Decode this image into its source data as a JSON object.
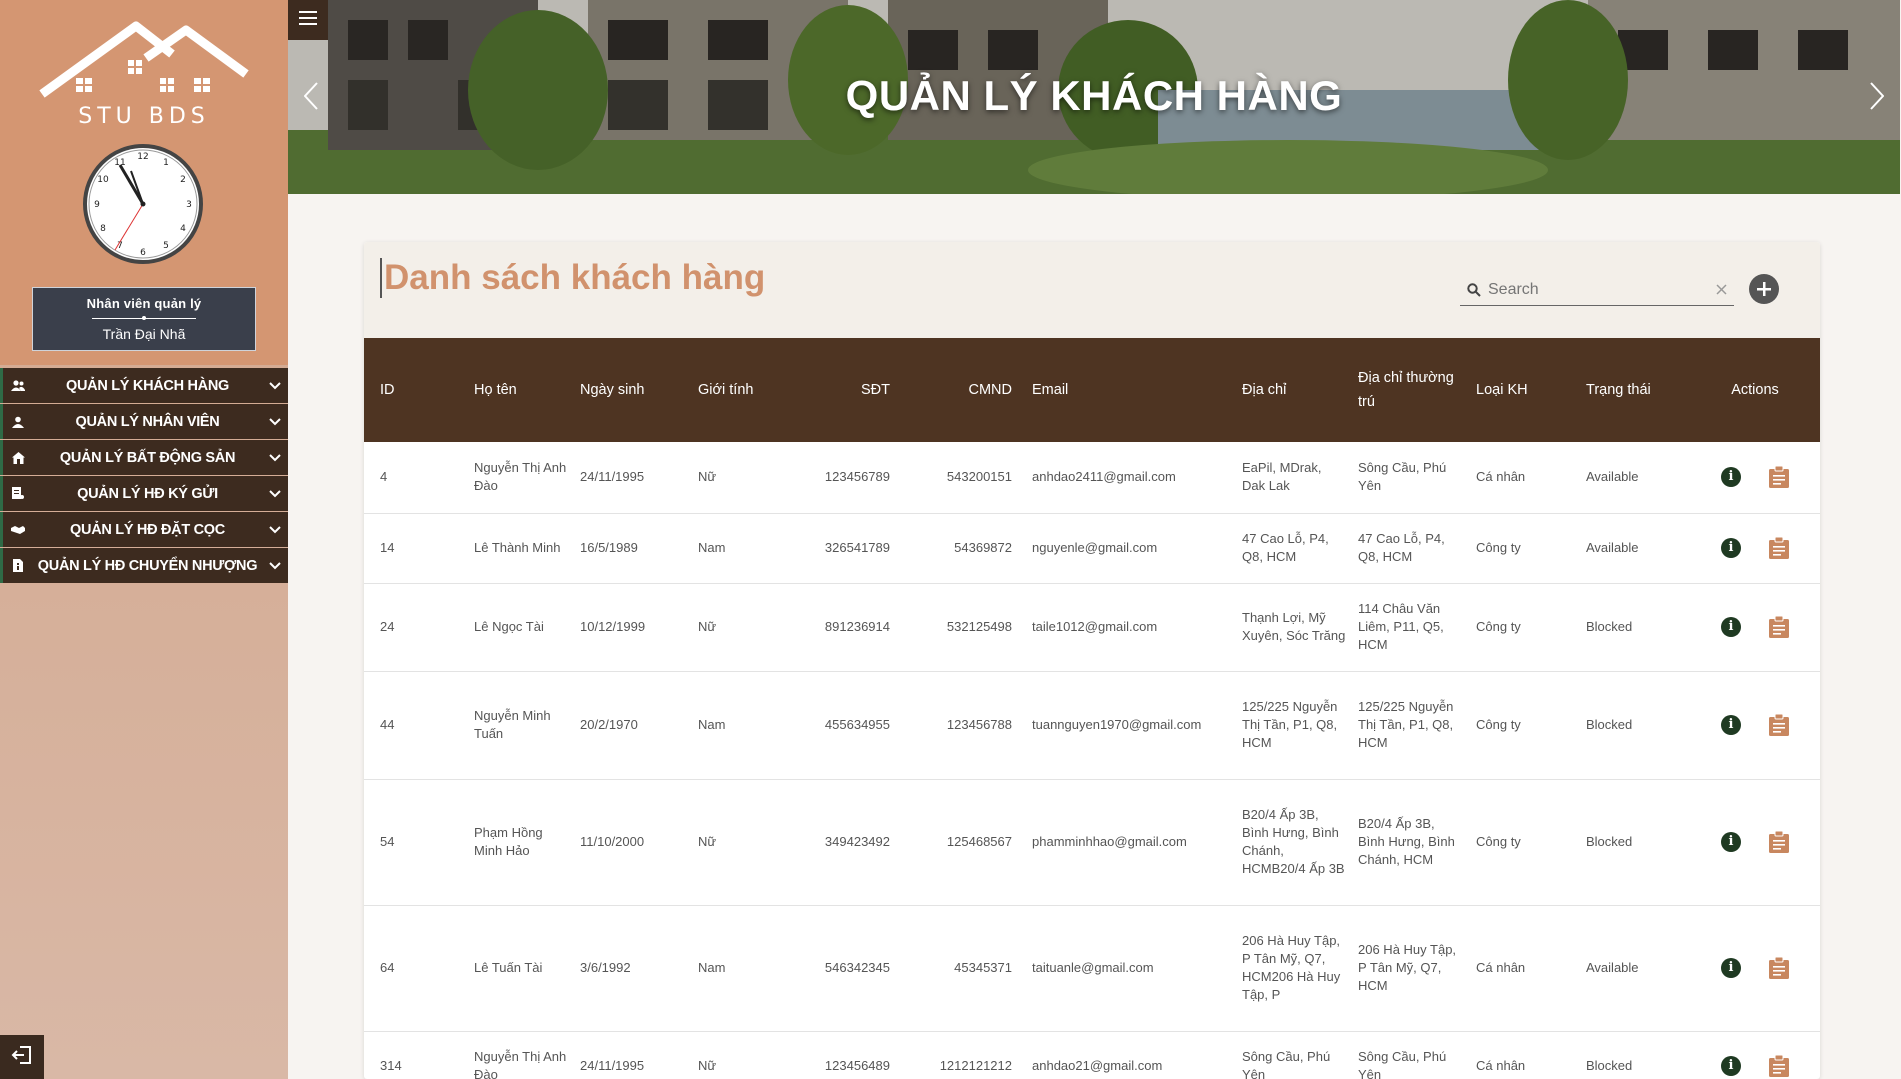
{
  "sidebar": {
    "logo_text": "STU BDS",
    "employee_role": "Nhân viên quản lý",
    "employee_name": "Trần Đại Nhã",
    "menu": [
      {
        "label": "QUẢN LÝ KHÁCH HÀNG",
        "icon": "users-icon"
      },
      {
        "label": "QUẢN LÝ NHÂN VIÊN",
        "icon": "user-icon"
      },
      {
        "label": "QUẢN LÝ BẤT ĐỘNG SẢN",
        "icon": "house-icon"
      },
      {
        "label": "QUẢN LÝ HĐ KÝ GỬI",
        "icon": "contract-icon"
      },
      {
        "label": "QUẢN LÝ HĐ ĐẶT CỌC",
        "icon": "handshake-icon"
      },
      {
        "label": "QUẢN LÝ HĐ CHUYỂN NHƯỢNG",
        "icon": "document-icon"
      }
    ]
  },
  "banner": {
    "title": "QUẢN LÝ KHÁCH HÀNG"
  },
  "card": {
    "title": "Danh sách khách hàng",
    "search_placeholder": "Search"
  },
  "table": {
    "columns": [
      "ID",
      "Họ tên",
      "Ngày sinh",
      "Giới tính",
      "SĐT",
      "CMND",
      "Email",
      "Địa chỉ",
      "Địa chỉ thường trú",
      "Loại KH",
      "Trạng thái",
      "Actions"
    ],
    "rows": [
      {
        "id": "4",
        "name": "Nguyễn Thị Anh Đào",
        "dob": "24/11/1995",
        "gender": "Nữ",
        "phone": "123456789",
        "cmnd": "543200151",
        "email": "anhdao2411@gmail.com",
        "address": "EaPil, MDrak, Dak Lak",
        "perm_address": "Sông Cầu, Phú Yên",
        "type": "Cá nhân",
        "status": "Available"
      },
      {
        "id": "14",
        "name": "Lê Thành Minh",
        "dob": "16/5/1989",
        "gender": "Nam",
        "phone": "326541789",
        "cmnd": "54369872",
        "email": "nguyenle@gmail.com",
        "address": "47 Cao Lỗ, P4, Q8, HCM",
        "perm_address": "47 Cao Lỗ, P4, Q8, HCM",
        "type": "Công ty",
        "status": "Available"
      },
      {
        "id": "24",
        "name": "Lê Ngọc Tài",
        "dob": "10/12/1999",
        "gender": "Nữ",
        "phone": "891236914",
        "cmnd": "532125498",
        "email": "taile1012@gmail.com",
        "address": "Thạnh Lợi, Mỹ Xuyên, Sóc Trăng",
        "perm_address": "114 Châu Văn Liêm, P11, Q5, HCM",
        "type": "Công ty",
        "status": "Blocked"
      },
      {
        "id": "44",
        "name": "Nguyễn Minh Tuấn",
        "dob": "20/2/1970",
        "gender": "Nam",
        "phone": "455634955",
        "cmnd": "123456788",
        "email": "tuannguyen1970@gmail.com",
        "address": "125/225 Nguyễn Thị Tần, P1, Q8, HCM",
        "perm_address": "125/225 Nguyễn Thị Tần, P1, Q8, HCM",
        "type": "Công ty",
        "status": "Blocked"
      },
      {
        "id": "54",
        "name": "Phạm Hồng Minh Hảo",
        "dob": "11/10/2000",
        "gender": "Nữ",
        "phone": "349423492",
        "cmnd": "125468567",
        "email": "phamminhhao@gmail.com",
        "address": "B20/4 Ấp 3B, Bình Hưng, Bình Chánh, HCMB20/4 Ấp 3B",
        "perm_address": "B20/4 Ấp 3B, Bình Hưng, Bình Chánh, HCM",
        "type": "Công ty",
        "status": "Blocked"
      },
      {
        "id": "64",
        "name": "Lê Tuấn Tài",
        "dob": "3/6/1992",
        "gender": "Nam",
        "phone": "546342345",
        "cmnd": "45345371",
        "email": "taituanle@gmail.com",
        "address": "206 Hà Huy Tập, P Tân Mỹ, Q7, HCM206 Hà Huy Tập, P",
        "perm_address": "206 Hà Huy Tập, P Tân Mỹ, Q7, HCM",
        "type": "Cá nhân",
        "status": "Available"
      },
      {
        "id": "314",
        "name": "Nguyễn Thị Anh Đào",
        "dob": "24/11/1995",
        "gender": "Nữ",
        "phone": "123456489",
        "cmnd": "1212121212",
        "email": "anhdao21@gmail.com",
        "address": "Sông Cầu, Phú Yên",
        "perm_address": "Sông Cầu, Phú Yên",
        "type": "Cá nhân",
        "status": "Blocked"
      }
    ]
  },
  "colors": {
    "sidebar_top": "#d49672",
    "menu_bg": "#3d2b1f",
    "table_header": "#4e3422",
    "title_accent": "#d1926d",
    "clipboard": "#c8875f",
    "info": "#1f3a22"
  }
}
